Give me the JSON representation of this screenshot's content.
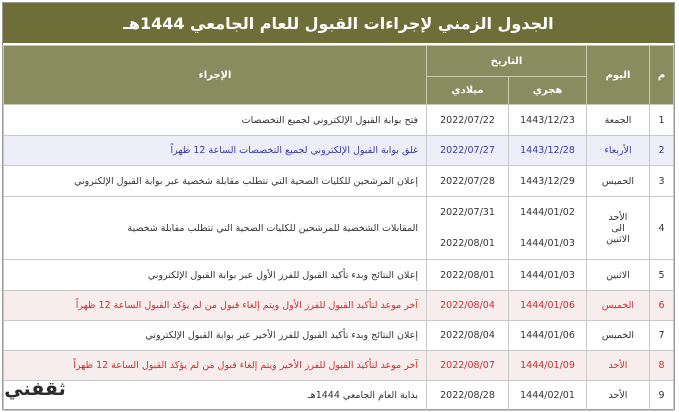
{
  "title": "الجدول الزمني لإجراءات القبول للعام الجامعي 1444هـ",
  "headers": {
    "num": "م",
    "day": "اليوم",
    "date": "التاريخ",
    "hijri": "هجري",
    "gregorian": "ميلادي",
    "action": "الإجراء"
  },
  "rows": [
    {
      "num": "1",
      "day": "الجمعة",
      "hijri": "1443/12/23",
      "greg": "2022/07/22",
      "action": "فتح بوابة القبول الإلكتروني لجميع التخصصات"
    },
    {
      "num": "2",
      "day": "الأربعاء",
      "hijri": "1443/12/28",
      "greg": "2022/07/27",
      "action": "غلق بوابة القبول الإلكتروني لجميع التخصصات الساعة 12 ظهراً"
    },
    {
      "num": "3",
      "day": "الخميس",
      "hijri": "1443/12/29",
      "greg": "2022/07/28",
      "action": "إعلان المرشحين للكليات الصحية التي تتطلب مقابلة شخصية عبر بوابة القبول الإلكتروني"
    },
    {
      "num": "4",
      "day_line1": "الأحد",
      "day_line2": "الى",
      "day_line3": "الاثنين",
      "hijri_line1": "1444/01/02",
      "hijri_line2": "1444/01/03",
      "greg_line1": "2022/07/31",
      "greg_line2": "2022/08/01",
      "action": "المقابلات الشخصية للمرشحين للكليات الصحية التي تتطلب مقابلة شخصية"
    },
    {
      "num": "5",
      "day": "الاثنين",
      "hijri": "1444/01/03",
      "greg": "2022/08/01",
      "action": "إعلان النتائج وبدء تأكيد القبول للفرز الأول عبر بوابة القبول الإلكتروني"
    },
    {
      "num": "6",
      "day": "الخميس",
      "hijri": "1444/01/06",
      "greg": "2022/08/04",
      "action": "آخر موعد لتأكيد القبول للفرز الأول ويتم إلغاء قبول من لم يؤكد القبول الساعة 12 ظهراً"
    },
    {
      "num": "7",
      "day": "الخميس",
      "hijri": "1444/01/06",
      "greg": "2022/08/04",
      "action": "إعلان النتائج وبدء تأكيد القبول للفرز الأخير عبر بوابة القبول الإلكتروني"
    },
    {
      "num": "8",
      "day": "الأحد",
      "hijri": "1444/01/09",
      "greg": "2022/08/07",
      "action": "آخر موعد لتأكيد القبول للفرز الأخير ويتم إلغاء قبول من لم يؤكد القبول الساعة 12 ظهراً"
    },
    {
      "num": "9",
      "day": "الأحد",
      "hijri": "1444/02/01",
      "greg": "2022/08/28",
      "action": "بداية العام الجامعي 1444هـ"
    }
  ],
  "logo_text": "ثقفني",
  "colors": {
    "title_bg": "#6e6e38",
    "header_bg": "#888c5e",
    "blue_text": "#3a3aa8",
    "red_text": "#cc2f2f"
  }
}
